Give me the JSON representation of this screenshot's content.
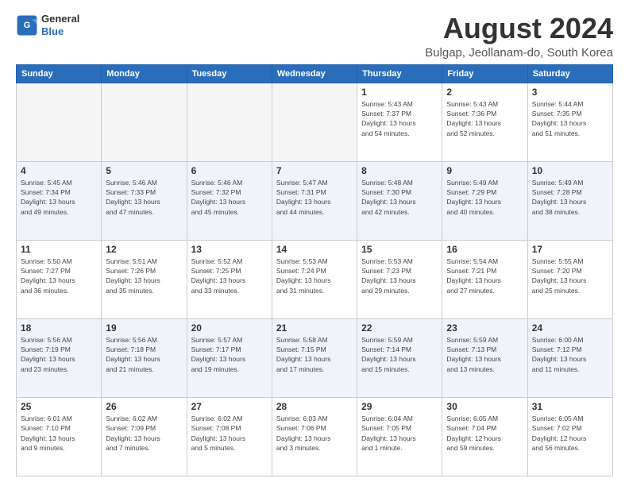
{
  "header": {
    "logo": {
      "line1": "General",
      "line2": "Blue"
    },
    "title": "August 2024",
    "subtitle": "Bulgap, Jeollanam-do, South Korea"
  },
  "weekdays": [
    "Sunday",
    "Monday",
    "Tuesday",
    "Wednesday",
    "Thursday",
    "Friday",
    "Saturday"
  ],
  "weeks": [
    [
      {
        "day": "",
        "info": ""
      },
      {
        "day": "",
        "info": ""
      },
      {
        "day": "",
        "info": ""
      },
      {
        "day": "",
        "info": ""
      },
      {
        "day": "1",
        "info": "Sunrise: 5:43 AM\nSunset: 7:37 PM\nDaylight: 13 hours\nand 54 minutes."
      },
      {
        "day": "2",
        "info": "Sunrise: 5:43 AM\nSunset: 7:36 PM\nDaylight: 13 hours\nand 52 minutes."
      },
      {
        "day": "3",
        "info": "Sunrise: 5:44 AM\nSunset: 7:35 PM\nDaylight: 13 hours\nand 51 minutes."
      }
    ],
    [
      {
        "day": "4",
        "info": "Sunrise: 5:45 AM\nSunset: 7:34 PM\nDaylight: 13 hours\nand 49 minutes."
      },
      {
        "day": "5",
        "info": "Sunrise: 5:46 AM\nSunset: 7:33 PM\nDaylight: 13 hours\nand 47 minutes."
      },
      {
        "day": "6",
        "info": "Sunrise: 5:46 AM\nSunset: 7:32 PM\nDaylight: 13 hours\nand 45 minutes."
      },
      {
        "day": "7",
        "info": "Sunrise: 5:47 AM\nSunset: 7:31 PM\nDaylight: 13 hours\nand 44 minutes."
      },
      {
        "day": "8",
        "info": "Sunrise: 5:48 AM\nSunset: 7:30 PM\nDaylight: 13 hours\nand 42 minutes."
      },
      {
        "day": "9",
        "info": "Sunrise: 5:49 AM\nSunset: 7:29 PM\nDaylight: 13 hours\nand 40 minutes."
      },
      {
        "day": "10",
        "info": "Sunrise: 5:49 AM\nSunset: 7:28 PM\nDaylight: 13 hours\nand 38 minutes."
      }
    ],
    [
      {
        "day": "11",
        "info": "Sunrise: 5:50 AM\nSunset: 7:27 PM\nDaylight: 13 hours\nand 36 minutes."
      },
      {
        "day": "12",
        "info": "Sunrise: 5:51 AM\nSunset: 7:26 PM\nDaylight: 13 hours\nand 35 minutes."
      },
      {
        "day": "13",
        "info": "Sunrise: 5:52 AM\nSunset: 7:25 PM\nDaylight: 13 hours\nand 33 minutes."
      },
      {
        "day": "14",
        "info": "Sunrise: 5:53 AM\nSunset: 7:24 PM\nDaylight: 13 hours\nand 31 minutes."
      },
      {
        "day": "15",
        "info": "Sunrise: 5:53 AM\nSunset: 7:23 PM\nDaylight: 13 hours\nand 29 minutes."
      },
      {
        "day": "16",
        "info": "Sunrise: 5:54 AM\nSunset: 7:21 PM\nDaylight: 13 hours\nand 27 minutes."
      },
      {
        "day": "17",
        "info": "Sunrise: 5:55 AM\nSunset: 7:20 PM\nDaylight: 13 hours\nand 25 minutes."
      }
    ],
    [
      {
        "day": "18",
        "info": "Sunrise: 5:56 AM\nSunset: 7:19 PM\nDaylight: 13 hours\nand 23 minutes."
      },
      {
        "day": "19",
        "info": "Sunrise: 5:56 AM\nSunset: 7:18 PM\nDaylight: 13 hours\nand 21 minutes."
      },
      {
        "day": "20",
        "info": "Sunrise: 5:57 AM\nSunset: 7:17 PM\nDaylight: 13 hours\nand 19 minutes."
      },
      {
        "day": "21",
        "info": "Sunrise: 5:58 AM\nSunset: 7:15 PM\nDaylight: 13 hours\nand 17 minutes."
      },
      {
        "day": "22",
        "info": "Sunrise: 5:59 AM\nSunset: 7:14 PM\nDaylight: 13 hours\nand 15 minutes."
      },
      {
        "day": "23",
        "info": "Sunrise: 5:59 AM\nSunset: 7:13 PM\nDaylight: 13 hours\nand 13 minutes."
      },
      {
        "day": "24",
        "info": "Sunrise: 6:00 AM\nSunset: 7:12 PM\nDaylight: 13 hours\nand 11 minutes."
      }
    ],
    [
      {
        "day": "25",
        "info": "Sunrise: 6:01 AM\nSunset: 7:10 PM\nDaylight: 13 hours\nand 9 minutes."
      },
      {
        "day": "26",
        "info": "Sunrise: 6:02 AM\nSunset: 7:09 PM\nDaylight: 13 hours\nand 7 minutes."
      },
      {
        "day": "27",
        "info": "Sunrise: 6:02 AM\nSunset: 7:08 PM\nDaylight: 13 hours\nand 5 minutes."
      },
      {
        "day": "28",
        "info": "Sunrise: 6:03 AM\nSunset: 7:06 PM\nDaylight: 13 hours\nand 3 minutes."
      },
      {
        "day": "29",
        "info": "Sunrise: 6:04 AM\nSunset: 7:05 PM\nDaylight: 13 hours\nand 1 minute."
      },
      {
        "day": "30",
        "info": "Sunrise: 6:05 AM\nSunset: 7:04 PM\nDaylight: 12 hours\nand 59 minutes."
      },
      {
        "day": "31",
        "info": "Sunrise: 6:05 AM\nSunset: 7:02 PM\nDaylight: 12 hours\nand 56 minutes."
      }
    ]
  ]
}
